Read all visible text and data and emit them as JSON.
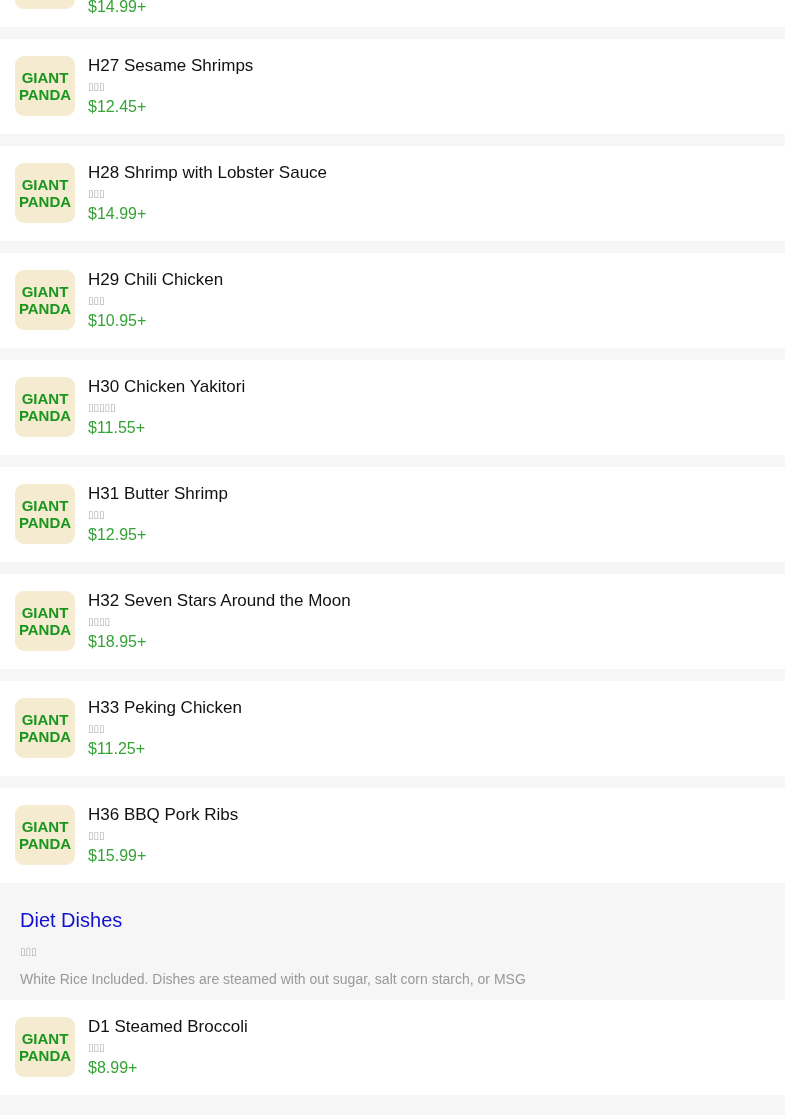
{
  "sections": [
    {
      "items": [
        {
          "price": "$14.99+"
        },
        {
          "logo": "GIANT PANDA",
          "name": "H27 Sesame Shrimps",
          "subtitle": "▯▯▯",
          "price": "$12.45+"
        },
        {
          "logo": "GIANT PANDA",
          "name": "H28 Shrimp with Lobster Sauce",
          "subtitle": "▯▯▯",
          "price": "$14.99+"
        },
        {
          "logo": "GIANT PANDA",
          "name": "H29 Chili Chicken",
          "subtitle": "▯▯▯",
          "price": "$10.95+"
        },
        {
          "logo": "GIANT PANDA",
          "name": "H30 Chicken Yakitori",
          "subtitle": "▯▯▯▯▯",
          "price": "$11.55+"
        },
        {
          "logo": "GIANT PANDA",
          "name": "H31 Butter Shrimp",
          "subtitle": "▯▯▯",
          "price": "$12.95+"
        },
        {
          "logo": "GIANT PANDA",
          "name": "H32 Seven Stars Around the Moon",
          "subtitle": "▯▯▯▯",
          "price": "$18.95+"
        },
        {
          "logo": "GIANT PANDA",
          "name": "H33 Peking Chicken",
          "subtitle": "▯▯▯",
          "price": "$11.25+"
        },
        {
          "logo": "GIANT PANDA",
          "name": "H36 BBQ Pork Ribs",
          "subtitle": "▯▯▯",
          "price": "$15.99+"
        }
      ]
    },
    {
      "title": "Diet Dishes",
      "subtitle": "▯▯▯",
      "description": "White Rice Included. Dishes are steamed with out sugar, salt corn starch, or MSG",
      "items": [
        {
          "logo": "GIANT PANDA",
          "name": "D1 Steamed Broccoli",
          "subtitle": "▯▯▯",
          "price": "$8.99+"
        }
      ]
    }
  ]
}
